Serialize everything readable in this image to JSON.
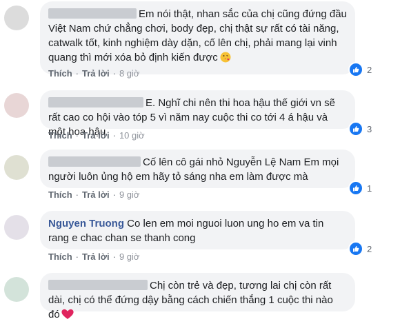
{
  "comments": [
    {
      "text": "Em nói thật, nhan sắc của chị cũng đứng đầu Việt Nam chứ chẳng chơi, body đẹp, chị thật sự rất có tài năng, catwalk tốt, kinh nghiệm dày dặn, cố lên chị, phải mang lại vinh quang thì mới xóa bỏ định kiến được",
      "reply_label": "Thích",
      "reply_action": "Trả lời",
      "time": "8 giờ",
      "likes": "2",
      "avatar_color": "#dcdcdc"
    },
    {
      "text": "E. Nghĩ chi nên thi hoa hậu thế giới vn sẽ rất cao co hội vào tóp 5 vì năm nay cuộc thi co tới 4 á hậu và một hoa hậu",
      "reply_label": "Thích",
      "reply_action": "Trả lời",
      "time": "10 giờ",
      "likes": "3",
      "avatar_color": "#e8d6d6"
    },
    {
      "text": "Cố lên cô gái nhỏ Nguyễn Lệ Nam Em mọi người luôn ủng hộ em hãy tỏ sáng nha em làm được mà",
      "reply_label": "Thích",
      "reply_action": "Trả lời",
      "time": "9 giờ",
      "likes": "1",
      "avatar_color": "#dfe0d2"
    },
    {
      "author": "Nguyen Truong",
      "text": "Co len em moi nguoi luon ung ho em va tin rang e chac chan se thanh cong",
      "reply_label": "Thích",
      "reply_action": "Trả lời",
      "time": "9 giờ",
      "likes": "2",
      "avatar_color": "#e4e0e8"
    },
    {
      "text": "Chị còn trẻ và đẹp, tương lai chị còn rất dài, chị có thể đứng dậy bằng cách chiến thắng 1 cuộc thi nào đó",
      "avatar_color": "#d3e3da"
    }
  ],
  "colors": {
    "like_blue": "#1877f2",
    "bubble": "#f2f3f5",
    "author": "#385898",
    "heart": "#e0245e"
  },
  "icons": [
    "like-icon",
    "heart-icon",
    "kiss-emoji-icon"
  ]
}
